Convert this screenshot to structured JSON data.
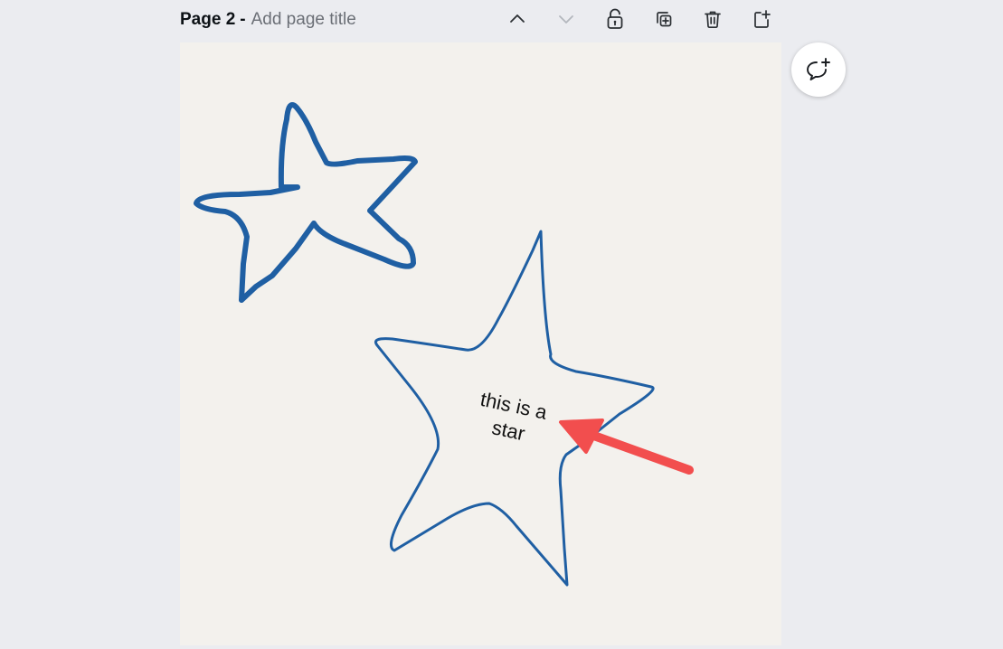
{
  "page_header": {
    "page_label": "Page 2",
    "separator": "-",
    "title_placeholder": "Add page title"
  },
  "toolbar": {
    "icons": [
      "chevron-up-icon",
      "chevron-down-icon",
      "unlock-icon",
      "duplicate-icon",
      "trash-icon",
      "add-page-icon"
    ]
  },
  "canvas": {
    "background": "#f3f1ed",
    "star_outline_color": "#1f5fa3",
    "arrow_color": "#f24e4e",
    "text_box": "this is a\nstar"
  },
  "comment_button": {
    "icon": "add-comment-icon"
  }
}
